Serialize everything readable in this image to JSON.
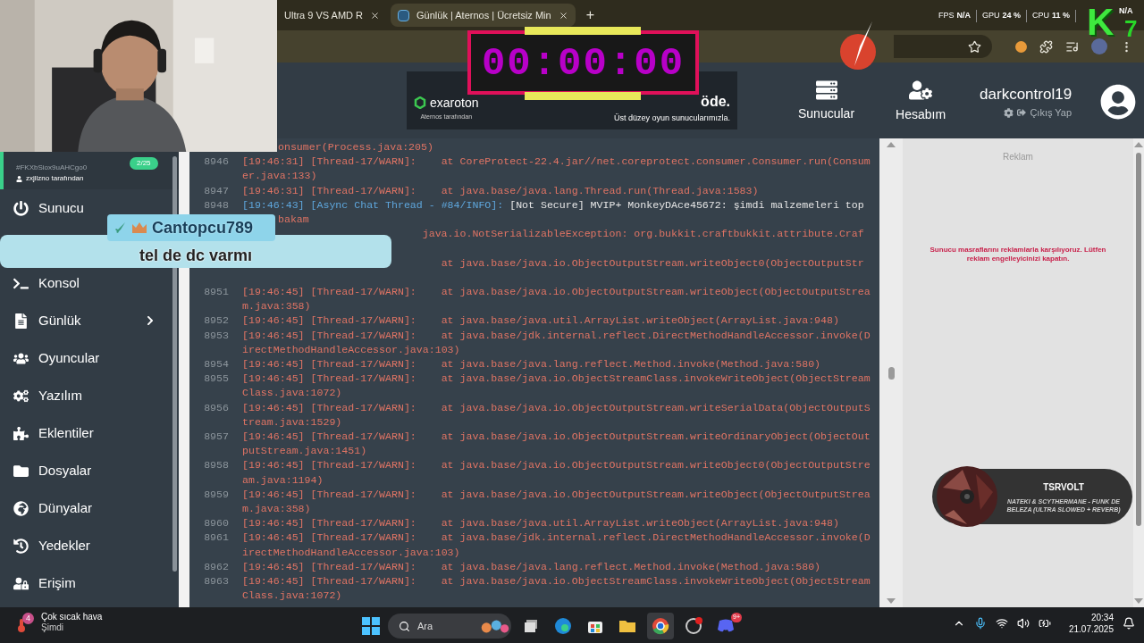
{
  "browser": {
    "tabs": [
      {
        "title": "Ultra 9 VS AMD R",
        "selected": false
      },
      {
        "title": "Günlük | Aternos | Ücretsiz Min",
        "selected": true
      }
    ],
    "new_tab": "+"
  },
  "header": {
    "ad_banner": {
      "brand": "exaroton",
      "brand_sub": "Aternos tarafından",
      "heading": "öde.",
      "subheading": "Üst düzey oyun sunucularımızla."
    },
    "nav": [
      {
        "label": "Sunucular"
      },
      {
        "label": "Hesabım"
      }
    ],
    "user": {
      "name": "darkcontrol19",
      "logout": "Çıkış Yap"
    }
  },
  "sidebar": {
    "server": {
      "id": "#FKXbSiox9uAHCgo0",
      "owner": "zxjllzno tarafından",
      "players": "2/25"
    },
    "items": [
      {
        "label": "Sunucu",
        "submenu": false
      },
      {
        "label": "Konsol",
        "submenu": false
      },
      {
        "label": "Günlük",
        "submenu": true
      },
      {
        "label": "Oyuncular",
        "submenu": false
      },
      {
        "label": "Yazılım",
        "submenu": false
      },
      {
        "label": "Eklentiler",
        "submenu": false
      },
      {
        "label": "Dosyalar",
        "submenu": false
      },
      {
        "label": "Dünyalar",
        "submenu": false
      },
      {
        "label": "Yedekler",
        "submenu": false
      },
      {
        "label": "Erişim",
        "submenu": false
      }
    ]
  },
  "console": {
    "lines": [
      {
        "kind": "continuation",
        "message": "onsumer(Process.java:205)"
      },
      {
        "kind": "trace",
        "number": "8946",
        "prefix": "[19:46:31] [Thread-17/WARN]:",
        "message": "at CoreProtect-22.4.jar//net.coreprotect.consumer.Consumer.run(Consumer.java:133)"
      },
      {
        "kind": "trace",
        "number": "8947",
        "prefix": "[19:46:31] [Thread-17/WARN]:",
        "message": "at java.base/java.lang.Thread.run(Thread.java:1583)"
      },
      {
        "kind": "info",
        "number": "8948",
        "prefix": "[19:46:43] [Async Chat Thread - #84/INFO]:",
        "message": "[Not Secure] MVIP+ MonkeyDAce45672: şimdi malzemeleri top"
      },
      {
        "kind": "continuation",
        "message": "bakam"
      },
      {
        "kind": "warn",
        "message": "java.io.NotSerializableException: org.bukkit.craftbukkit.attribute.Craf"
      },
      {
        "kind": "trace",
        "message": "at java.base/java.io.ObjectOutputStream.writeObject0(ObjectOutputStr"
      },
      {
        "kind": "trace",
        "number": "8951",
        "prefix": "[19:46:45] [Thread-17/WARN]:",
        "message": "at java.base/java.io.ObjectOutputStream.writeObject(ObjectOutputStream.java:358)"
      },
      {
        "kind": "trace",
        "number": "8952",
        "prefix": "[19:46:45] [Thread-17/WARN]:",
        "message": "at java.base/java.util.ArrayList.writeObject(ArrayList.java:948)"
      },
      {
        "kind": "trace",
        "number": "8953",
        "prefix": "[19:46:45] [Thread-17/WARN]:",
        "message": "at java.base/jdk.internal.reflect.DirectMethodHandleAccessor.invoke(DirectMethodHandleAccessor.java:103)"
      },
      {
        "kind": "trace",
        "number": "8954",
        "prefix": "[19:46:45] [Thread-17/WARN]:",
        "message": "at java.base/java.lang.reflect.Method.invoke(Method.java:580)"
      },
      {
        "kind": "trace",
        "number": "8955",
        "prefix": "[19:46:45] [Thread-17/WARN]:",
        "message": "at java.base/java.io.ObjectStreamClass.invokeWriteObject(ObjectStreamClass.java:1072)"
      },
      {
        "kind": "trace",
        "number": "8956",
        "prefix": "[19:46:45] [Thread-17/WARN]:",
        "message": "at java.base/java.io.ObjectOutputStream.writeSerialData(ObjectOutputStream.java:1529)"
      },
      {
        "kind": "trace",
        "number": "8957",
        "prefix": "[19:46:45] [Thread-17/WARN]:",
        "message": "at java.base/java.io.ObjectOutputStream.writeOrdinaryObject(ObjectOutputStream.java:1451)"
      },
      {
        "kind": "trace",
        "number": "8958",
        "prefix": "[19:46:45] [Thread-17/WARN]:",
        "message": "at java.base/java.io.ObjectOutputStream.writeObject0(ObjectOutputStream.java:1194)"
      },
      {
        "kind": "trace",
        "number": "8959",
        "prefix": "[19:46:45] [Thread-17/WARN]:",
        "message": "at java.base/java.io.ObjectOutputStream.writeObject(ObjectOutputStream.java:358)"
      },
      {
        "kind": "trace",
        "number": "8960",
        "prefix": "[19:46:45] [Thread-17/WARN]:",
        "message": "at java.base/java.util.ArrayList.writeObject(ArrayList.java:948)"
      },
      {
        "kind": "trace",
        "number": "8961",
        "prefix": "[19:46:45] [Thread-17/WARN]:",
        "message": "at java.base/jdk.internal.reflect.DirectMethodHandleAccessor.invoke(DirectMethodHandleAccessor.java:103)"
      },
      {
        "kind": "trace",
        "number": "8962",
        "prefix": "[19:46:45] [Thread-17/WARN]:",
        "message": "at java.base/java.lang.reflect.Method.invoke(Method.java:580)"
      },
      {
        "kind": "trace",
        "number": "8963",
        "prefix": "[19:46:45] [Thread-17/WARN]:",
        "message": "at java.base/java.io.ObjectStreamClass.invokeWriteObject(ObjectStreamClass.java:1072)"
      }
    ]
  },
  "ad_panel": {
    "label": "Reklam",
    "notice": "Sunucu masraflarını reklamlarla karşılıyoruz. Lütfen reklam engelleyicinizi kapatın."
  },
  "taskbar": {
    "weather": {
      "badge": "4",
      "title": "Çok sıcak hava",
      "subtitle": "Şimdi"
    },
    "search": {
      "placeholder": "Ara"
    },
    "app_badge": "9+",
    "time": "20:34",
    "date": "21.07.2025"
  },
  "overlays": {
    "timer": "00:00:00",
    "chat": {
      "user": "Cantopcu789",
      "message": "tel de dc varmı"
    },
    "stats": [
      {
        "label": "FPS",
        "value": "N/A"
      },
      {
        "label": "GPU",
        "value": "24 %"
      },
      {
        "label": "CPU",
        "value": "11 %"
      }
    ],
    "stats_extra": "N/A",
    "logo": {
      "letter": "K",
      "digit": "7"
    },
    "now_playing": {
      "artist": "TSRVOLT",
      "track": "NATEKI & SCYTHERMANE - FUNK DE BELEZA (ULTRA SLOWED + REVERB)"
    }
  }
}
